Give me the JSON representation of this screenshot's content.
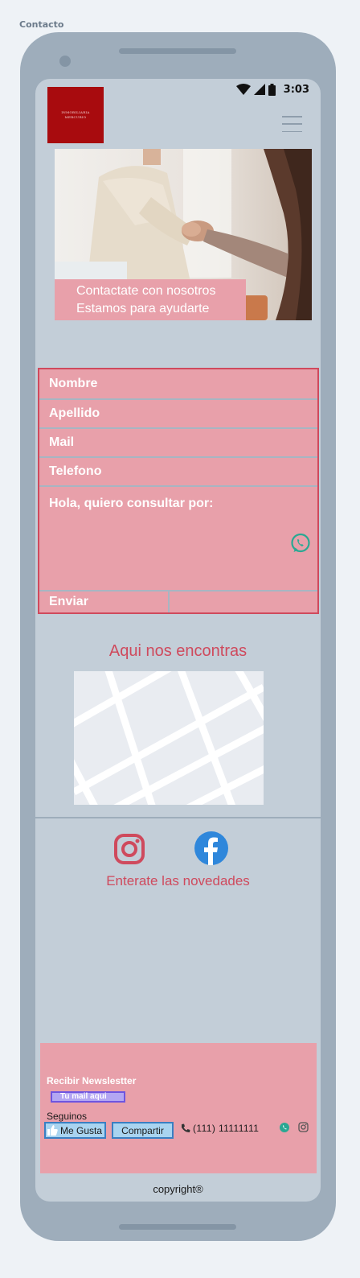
{
  "page": {
    "label": "Contacto"
  },
  "status_bar": {
    "time": "3:03",
    "icons": [
      "wifi-icon",
      "signal-icon",
      "battery-icon"
    ]
  },
  "header": {
    "logo_line1": "INMOBILIARIA",
    "logo_line2": "MERCURIO",
    "menu_icon": "hamburger-menu-icon"
  },
  "hero": {
    "caption_line1": "Contactate con nosotros",
    "caption_line2": "Estamos para ayudarte"
  },
  "form": {
    "nombre_placeholder": "Nombre",
    "apellido_placeholder": "Apellido",
    "mail_placeholder": "Mail",
    "telefono_placeholder": "Telefono",
    "message_value": "Hola, quiero consultar por:",
    "submit_label": "Enviar"
  },
  "location": {
    "title": "Aqui nos encontras"
  },
  "social": {
    "tagline": "Enterate las novedades"
  },
  "footer": {
    "newsletter_label": "Recibir Newslestter",
    "newsletter_placeholder": "Tu mail aqui",
    "follow_label": "Seguinos",
    "like_label": "Me Gusta",
    "share_label": "Compartir",
    "phone": "(111) 11111111"
  },
  "copyright": "copyright®",
  "colors": {
    "accent": "#cf4a5d",
    "pink": "#e8a0aa",
    "screen_bg": "#c3ced8",
    "logo_red": "#a80b0e"
  }
}
